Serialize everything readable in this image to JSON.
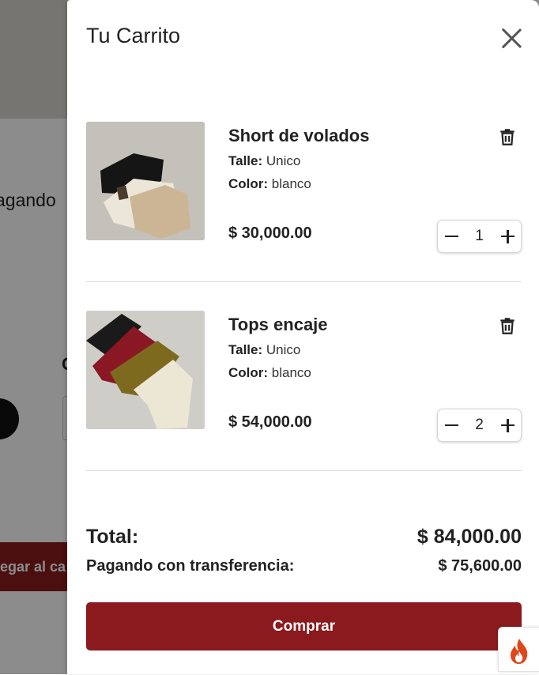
{
  "background": {
    "partial_text": "agando",
    "partial_char": "C",
    "partial_button": "egar al ca"
  },
  "cart": {
    "title": "Tu Carrito",
    "items": [
      {
        "name": "Short de volados",
        "size_label": "Talle:",
        "size": "Unico",
        "color_label": "Color:",
        "color": "blanco",
        "price": "$ 30,000.00",
        "quantity": "1"
      },
      {
        "name": "Tops encaje",
        "size_label": "Talle:",
        "size": "Unico",
        "color_label": "Color:",
        "color": "blanco",
        "price": "$ 54,000.00",
        "quantity": "2"
      }
    ],
    "total_label": "Total:",
    "total_value": "$ 84,000.00",
    "transfer_label": "Pagando con transferencia:",
    "transfer_value": "$ 75,600.00",
    "buy_label": "Comprar"
  },
  "colors": {
    "accent": "#8a1a1e",
    "overlay": "rgba(0,0,0,0.45)"
  },
  "icons": [
    "close-icon",
    "trash-icon",
    "minus-icon",
    "plus-icon",
    "fire-icon"
  ]
}
